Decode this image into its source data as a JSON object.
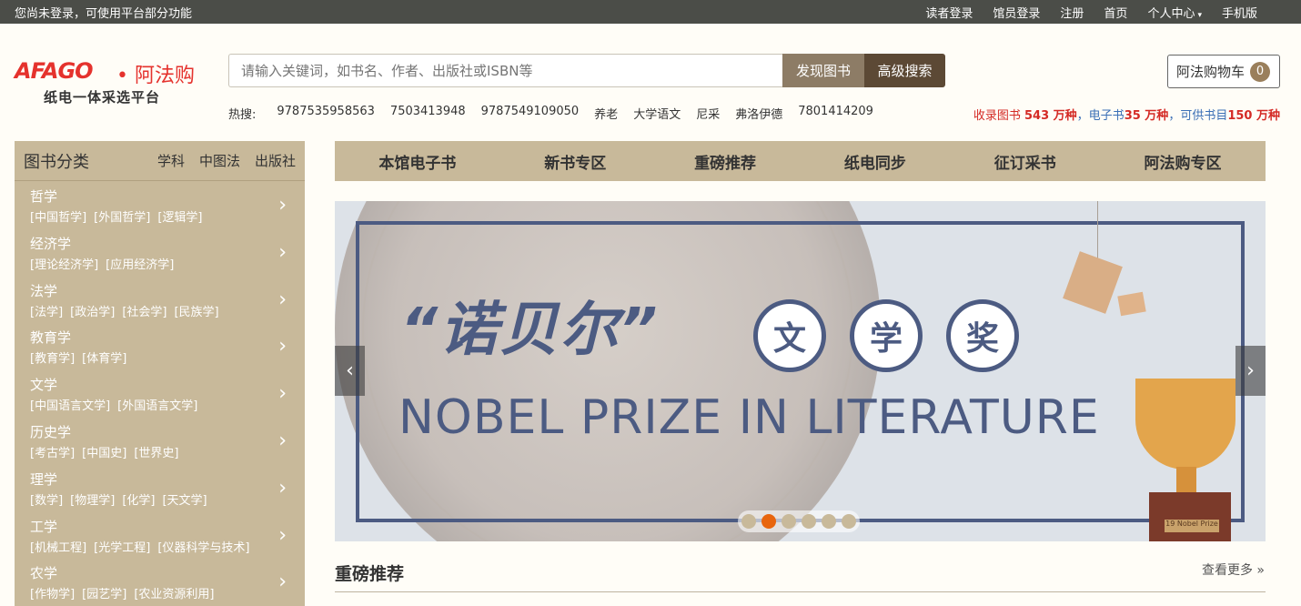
{
  "topbar": {
    "notice": "您尚未登录，可使用平台部分功能",
    "nav": [
      {
        "label": "读者登录"
      },
      {
        "label": "馆员登录"
      },
      {
        "label": "注册"
      },
      {
        "label": "首页"
      },
      {
        "label": "个人中心",
        "caret": "▾"
      },
      {
        "label": "手机版"
      }
    ]
  },
  "logo": {
    "brand": "AFAGO",
    "brand_cn": "• 阿法购",
    "tagline": "纸电一体采选平台"
  },
  "search": {
    "placeholder": "请输入关键词，如书名、作者、出版社或ISBN等",
    "discover_label": "发现图书",
    "advanced_label": "高级搜索"
  },
  "hot": {
    "label": "热搜:",
    "items": [
      "9787535958563",
      "7503413948",
      "9787549109050",
      "养老",
      "大学语文",
      "尼采",
      "弗洛伊德",
      "7801414209"
    ]
  },
  "cart": {
    "label": "阿法购物车",
    "count": "0"
  },
  "stats": {
    "p1": "收录图书 ",
    "v1": "543 万种",
    "p2": "，电子书",
    "v2": "35 万种",
    "p3": "，可供书目",
    "v3": "150 万种"
  },
  "sidebar": {
    "title": "图书分类",
    "tabs": [
      "学科",
      "中图法",
      "出版社"
    ],
    "arrow": "›",
    "categories": [
      {
        "name": "哲学",
        "subs": [
          "[中国哲学]",
          "[外国哲学]",
          "[逻辑学]"
        ]
      },
      {
        "name": "经济学",
        "subs": [
          "[理论经济学]",
          "[应用经济学]"
        ]
      },
      {
        "name": "法学",
        "subs": [
          "[法学]",
          "[政治学]",
          "[社会学]",
          "[民族学]"
        ]
      },
      {
        "name": "教育学",
        "subs": [
          "[教育学]",
          "[体育学]"
        ]
      },
      {
        "name": "文学",
        "subs": [
          "[中国语言文学]",
          "[外国语言文学]"
        ]
      },
      {
        "name": "历史学",
        "subs": [
          "[考古学]",
          "[中国史]",
          "[世界史]"
        ]
      },
      {
        "name": "理学",
        "subs": [
          "[数学]",
          "[物理学]",
          "[化学]",
          "[天文学]"
        ]
      },
      {
        "name": "工学",
        "subs": [
          "[机械工程]",
          "[光学工程]",
          "[仪器科学与技术]"
        ]
      },
      {
        "name": "农学",
        "subs": [
          "[作物学]",
          "[园艺学]",
          "[农业资源利用]"
        ]
      }
    ]
  },
  "mainnav": [
    "本馆电子书",
    "新书专区",
    "重磅推荐",
    "纸电同步",
    "征订采书",
    "阿法购专区"
  ],
  "banner": {
    "title_cn": "“诺贝尔”",
    "badges": [
      "文",
      "学",
      "奖"
    ],
    "title_en": "NOBEL PRIZE IN LITERATURE",
    "plate": "19 Nobel Prize",
    "prev": "‹",
    "next": "›",
    "slides": 6,
    "active_slide": 2
  },
  "section": {
    "title": "重磅推荐",
    "more": "查看更多 »"
  }
}
